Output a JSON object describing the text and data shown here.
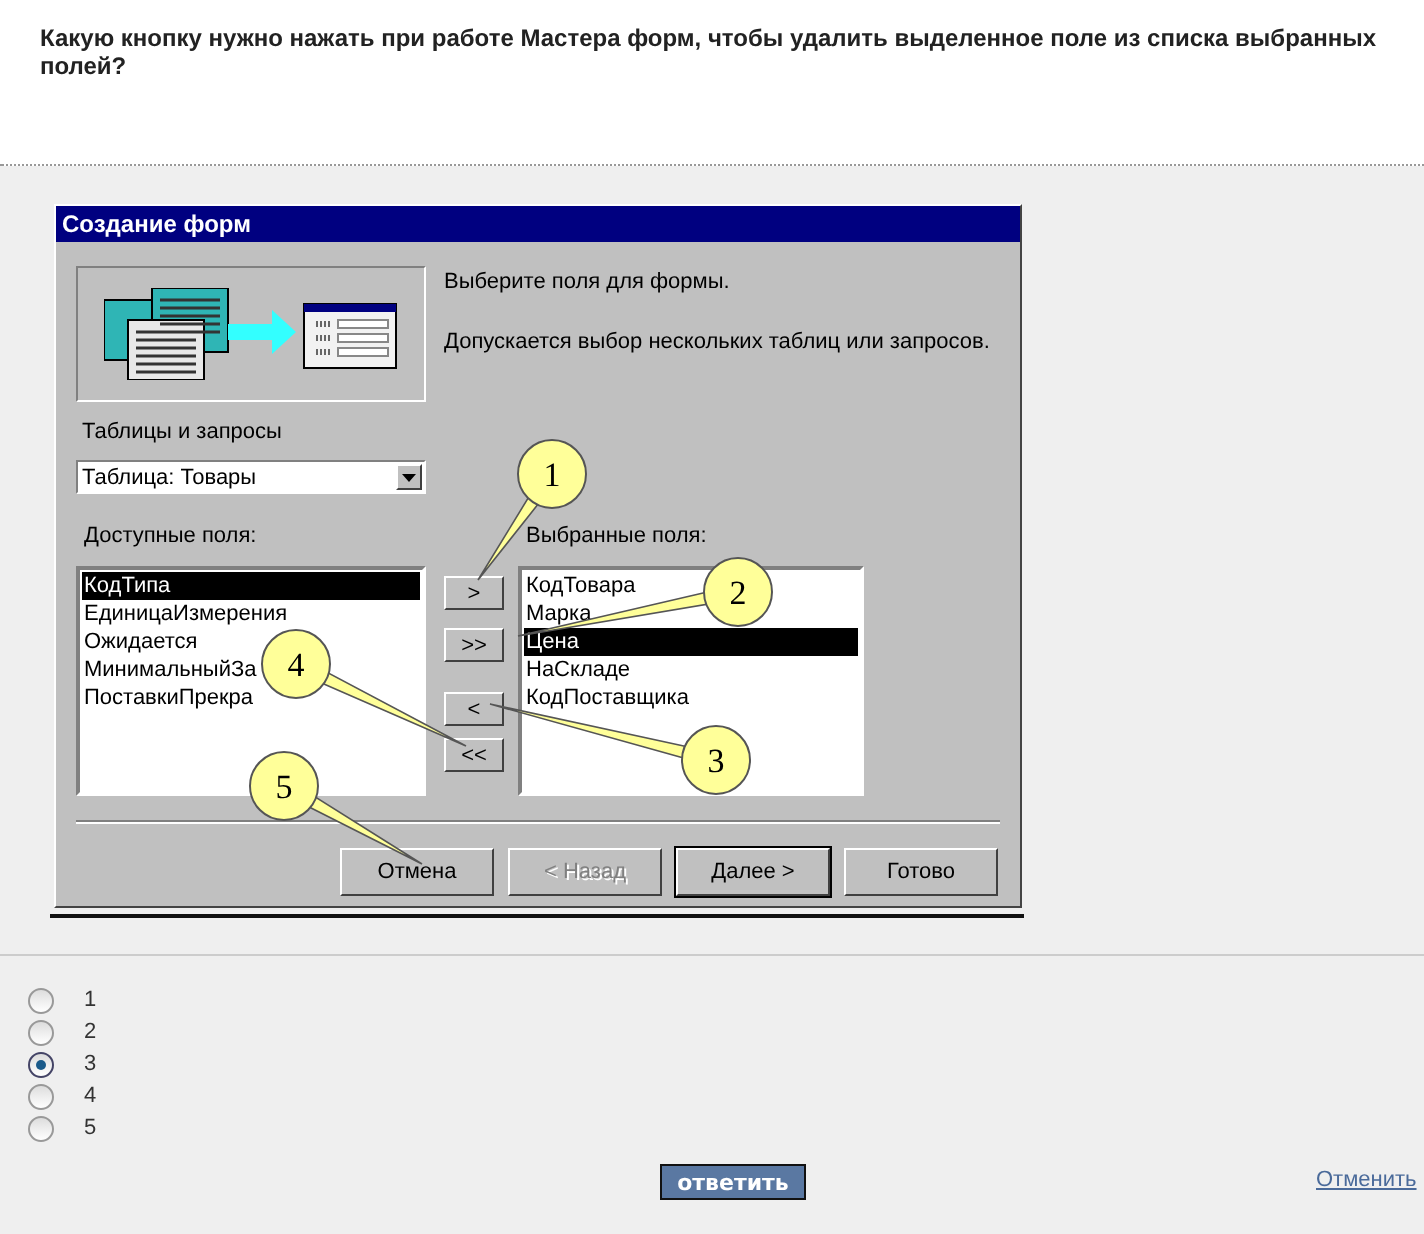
{
  "question": "Какую кнопку нужно нажать при работе Мастера форм, чтобы удалить выделенное поле из списка выбранных полей?",
  "dialog": {
    "title": "Создание форм",
    "instruction": "Выберите поля для формы.",
    "note": "Допускается выбор нескольких таблиц или запросов.",
    "tables_label": "Таблицы и запросы",
    "tables_combo": {
      "value": "Таблица: Товары"
    },
    "available_label": "Доступные поля:",
    "available_fields": [
      {
        "text": "КодТипа",
        "selected": true
      },
      {
        "text": "ЕдиницаИзмерения",
        "selected": false
      },
      {
        "text": "Ожидается",
        "selected": false
      },
      {
        "text": "МинимальныйЗа",
        "selected": false
      },
      {
        "text": "ПоставкиПрекра",
        "selected": false
      }
    ],
    "selected_label": "Выбранные поля:",
    "selected_fields": [
      {
        "text": "КодТовара",
        "selected": false
      },
      {
        "text": "Марка",
        "selected": false
      },
      {
        "text": "Цена",
        "selected": true
      },
      {
        "text": "НаСкладе",
        "selected": false
      },
      {
        "text": "КодПоставщика",
        "selected": false
      }
    ],
    "move_buttons": [
      ">",
      ">>",
      "<",
      "<<"
    ],
    "buttons": [
      {
        "label": "Отмена",
        "disabled": false,
        "default": false
      },
      {
        "label": "< Назад",
        "disabled": true,
        "default": false
      },
      {
        "label": "Далее >",
        "disabled": false,
        "default": true
      },
      {
        "label": "Готово",
        "disabled": false,
        "default": false
      }
    ]
  },
  "callouts": [
    "1",
    "2",
    "3",
    "4",
    "5"
  ],
  "answers": [
    {
      "label": "1",
      "selected": false
    },
    {
      "label": "2",
      "selected": false
    },
    {
      "label": "3",
      "selected": true
    },
    {
      "label": "4",
      "selected": false
    },
    {
      "label": "5",
      "selected": false
    }
  ],
  "submit": "ответить",
  "cancel_link": "Отменить"
}
